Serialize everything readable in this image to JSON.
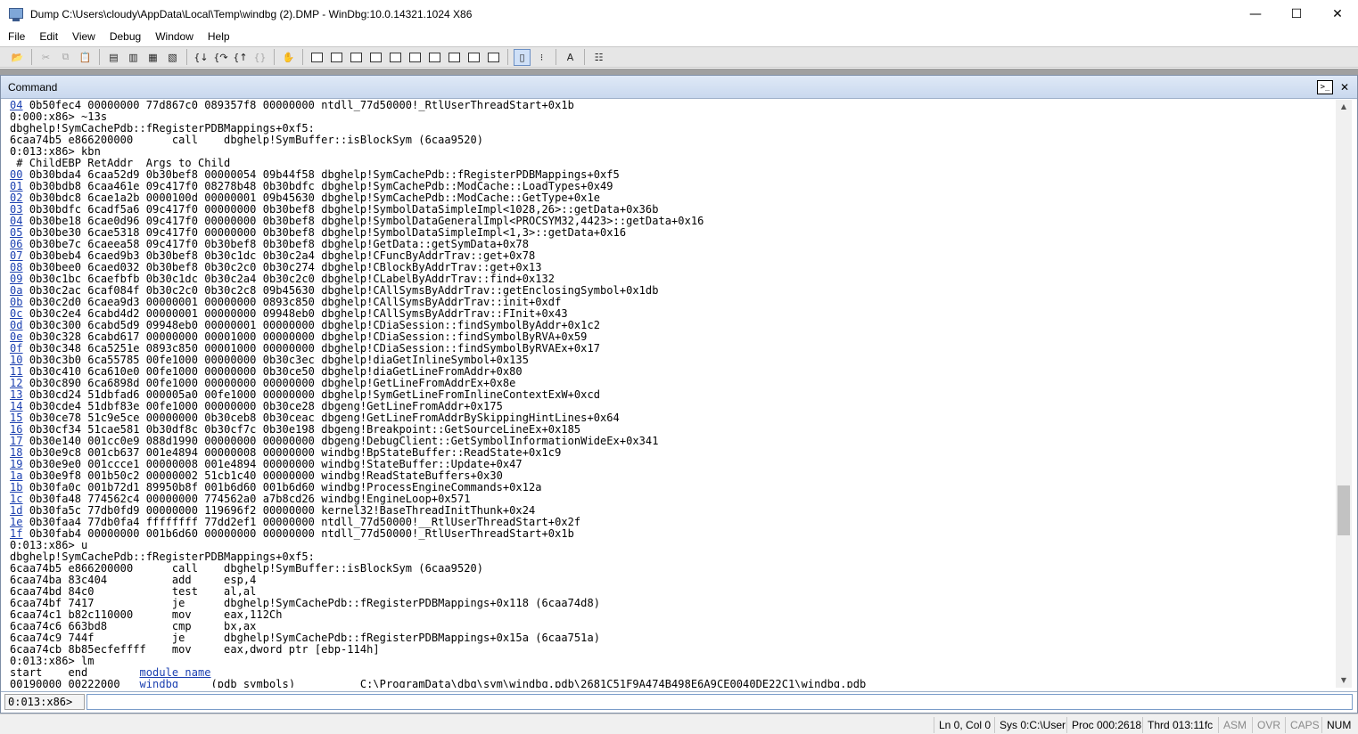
{
  "window": {
    "title": "Dump C:\\Users\\cloudy\\AppData\\Local\\Temp\\windbg (2).DMP - WinDbg:10.0.14321.1024 X86",
    "minimize": "—",
    "maximize": "☐",
    "close": "✕"
  },
  "menu": [
    "File",
    "Edit",
    "View",
    "Debug",
    "Window",
    "Help"
  ],
  "command_window": {
    "title": "Command",
    "prompt_icon": ">_",
    "close": "✕",
    "input_prompt": "0:013:x86>",
    "input_value": ""
  },
  "output": [
    {
      "id": "04",
      "text": " 0b50fec4 00000000 77d867c0 089357f8 00000000 ntdll_77d50000!_RtlUserThreadStart+0x1b"
    },
    {
      "text": "0:000:x86> ~13s"
    },
    {
      "text": "dbghelp!SymCachePdb::fRegisterPDBMappings+0xf5:"
    },
    {
      "text": "6caa74b5 e866200000      call    dbghelp!SymBuffer::isBlockSym (6caa9520)"
    },
    {
      "text": "0:013:x86> kbn"
    },
    {
      "text": " # ChildEBP RetAddr  Args to Child"
    },
    {
      "id": "00",
      "text": " 0b30bda4 6caa52d9 0b30bef8 00000054 09b44f58 dbghelp!SymCachePdb::fRegisterPDBMappings+0xf5"
    },
    {
      "id": "01",
      "text": " 0b30bdb8 6caa461e 09c417f0 08278b48 0b30bdfc dbghelp!SymCachePdb::ModCache::LoadTypes+0x49"
    },
    {
      "id": "02",
      "text": " 0b30bdc8 6cae1a2b 0000100d 00000001 09b45630 dbghelp!SymCachePdb::ModCache::GetType+0x1e"
    },
    {
      "id": "03",
      "text": " 0b30bdfc 6cadf5a6 09c417f0 00000000 0b30bef8 dbghelp!SymbolDataSimpleImpl<1028,26>::getData+0x36b"
    },
    {
      "id": "04",
      "text": " 0b30be18 6cae0d96 09c417f0 00000000 0b30bef8 dbghelp!SymbolDataGeneralImpl<PROCSYM32,4423>::getData+0x16"
    },
    {
      "id": "05",
      "text": " 0b30be30 6cae5318 09c417f0 00000000 0b30bef8 dbghelp!SymbolDataSimpleImpl<1,3>::getData+0x16"
    },
    {
      "id": "06",
      "text": " 0b30be7c 6caeea58 09c417f0 0b30bef8 0b30bef8 dbghelp!GetData::getSymData+0x78"
    },
    {
      "id": "07",
      "text": " 0b30beb4 6caed9b3 0b30bef8 0b30c1dc 0b30c2a4 dbghelp!CFuncByAddrTrav::get+0x78"
    },
    {
      "id": "08",
      "text": " 0b30bee0 6caed032 0b30bef8 0b30c2c0 0b30c274 dbghelp!CBlockByAddrTrav::get+0x13"
    },
    {
      "id": "09",
      "text": " 0b30c1bc 6caefbfb 0b30c1dc 0b30c2a4 0b30c2c0 dbghelp!CLabelByAddrTrav::find+0x132"
    },
    {
      "id": "0a",
      "text": " 0b30c2ac 6caf084f 0b30c2c0 0b30c2c8 09b45630 dbghelp!CAllSymsByAddrTrav::getEnclosingSymbol+0x1db"
    },
    {
      "id": "0b",
      "text": " 0b30c2d0 6caea9d3 00000001 00000000 0893c850 dbghelp!CAllSymsByAddrTrav::init+0xdf"
    },
    {
      "id": "0c",
      "text": " 0b30c2e4 6cabd4d2 00000001 00000000 09948eb0 dbghelp!CAllSymsByAddrTrav::FInit+0x43"
    },
    {
      "id": "0d",
      "text": " 0b30c300 6cabd5d9 09948eb0 00000001 00000000 dbghelp!CDiaSession::findSymbolByAddr+0x1c2"
    },
    {
      "id": "0e",
      "text": " 0b30c328 6cabd617 00000000 00001000 00000000 dbghelp!CDiaSession::findSymbolByRVA+0x59"
    },
    {
      "id": "0f",
      "text": " 0b30c348 6ca5251e 0893c850 00001000 00000000 dbghelp!CDiaSession::findSymbolByRVAEx+0x17"
    },
    {
      "id": "10",
      "text": " 0b30c3b0 6ca55785 00fe1000 00000000 0b30c3ec dbghelp!diaGetInlineSymbol+0x135"
    },
    {
      "id": "11",
      "text": " 0b30c410 6ca610e0 00fe1000 00000000 0b30ce50 dbghelp!diaGetLineFromAddr+0x80"
    },
    {
      "id": "12",
      "text": " 0b30c890 6ca6898d 00fe1000 00000000 00000000 dbghelp!GetLineFromAddrEx+0x8e"
    },
    {
      "id": "13",
      "text": " 0b30cd24 51dbfad6 000005a0 00fe1000 00000000 dbghelp!SymGetLineFromInlineContextExW+0xcd"
    },
    {
      "id": "14",
      "text": " 0b30cde4 51dbf83e 00fe1000 00000000 0b30ce28 dbgeng!GetLineFromAddr+0x175"
    },
    {
      "id": "15",
      "text": " 0b30ce78 51c9e5ce 00000000 0b30ceb8 0b30ceac dbgeng!GetLineFromAddrBySkippingHintLines+0x64"
    },
    {
      "id": "16",
      "text": " 0b30cf34 51cae581 0b30df8c 0b30cf7c 0b30e198 dbgeng!Breakpoint::GetSourceLineEx+0x185"
    },
    {
      "id": "17",
      "text": " 0b30e140 001cc0e9 088d1990 00000000 00000000 dbgeng!DebugClient::GetSymbolInformationWideEx+0x341"
    },
    {
      "id": "18",
      "text": " 0b30e9c8 001cb637 001e4894 00000008 00000000 windbg!BpStateBuffer::ReadState+0x1c9"
    },
    {
      "id": "19",
      "text": " 0b30e9e0 001ccce1 00000008 001e4894 00000000 windbg!StateBuffer::Update+0x47"
    },
    {
      "id": "1a",
      "text": " 0b30e9f8 001b50c2 00000002 51cb1c40 00000000 windbg!ReadStateBuffers+0x30"
    },
    {
      "id": "1b",
      "text": " 0b30fa0c 001b72d1 89950b8f 001b6d60 001b6d60 windbg!ProcessEngineCommands+0x12a"
    },
    {
      "id": "1c",
      "text": " 0b30fa48 774562c4 00000000 774562a0 a7b8cd26 windbg!EngineLoop+0x571"
    },
    {
      "id": "1d",
      "text": " 0b30fa5c 77db0fd9 00000000 119696f2 00000000 kernel32!BaseThreadInitThunk+0x24"
    },
    {
      "id": "1e",
      "text": " 0b30faa4 77db0fa4 ffffffff 77dd2ef1 00000000 ntdll_77d50000!__RtlUserThreadStart+0x2f"
    },
    {
      "id": "1f",
      "text": " 0b30fab4 00000000 001b6d60 00000000 00000000 ntdll_77d50000!_RtlUserThreadStart+0x1b"
    },
    {
      "text": "0:013:x86> u"
    },
    {
      "text": "dbghelp!SymCachePdb::fRegisterPDBMappings+0xf5:"
    },
    {
      "text": "6caa74b5 e866200000      call    dbghelp!SymBuffer::isBlockSym (6caa9520)"
    },
    {
      "text": "6caa74ba 83c404          add     esp,4"
    },
    {
      "text": "6caa74bd 84c0            test    al,al"
    },
    {
      "text": "6caa74bf 7417            je      dbghelp!SymCachePdb::fRegisterPDBMappings+0x118 (6caa74d8)"
    },
    {
      "text": "6caa74c1 b82c110000      mov     eax,112Ch"
    },
    {
      "text": "6caa74c6 663bd8          cmp     bx,ax"
    },
    {
      "text": "6caa74c9 744f            je      dbghelp!SymCachePdb::fRegisterPDBMappings+0x15a (6caa751a)"
    },
    {
      "text": "6caa74cb 8b85ecfeffff    mov     eax,dword ptr [ebp-114h]"
    },
    {
      "text": "0:013:x86> lm"
    },
    {
      "pre": "start    end        ",
      "link": "module name",
      "text": ""
    },
    {
      "pre": "00190000 00222000   ",
      "link": "windbg",
      "text": "     (pdb symbols)          C:\\ProgramData\\dbg\\sym\\windbg.pdb\\2681C51F9A474B498E6A9CE0040DE22C1\\windbg.pdb"
    }
  ],
  "status": {
    "position": "Ln 0, Col 0",
    "sys": "Sys 0:C:\\User",
    "proc": "Proc 000:2618",
    "thread": "Thrd 013:11fc",
    "asm": "ASM",
    "ovr": "OVR",
    "caps": "CAPS",
    "num": "NUM"
  }
}
